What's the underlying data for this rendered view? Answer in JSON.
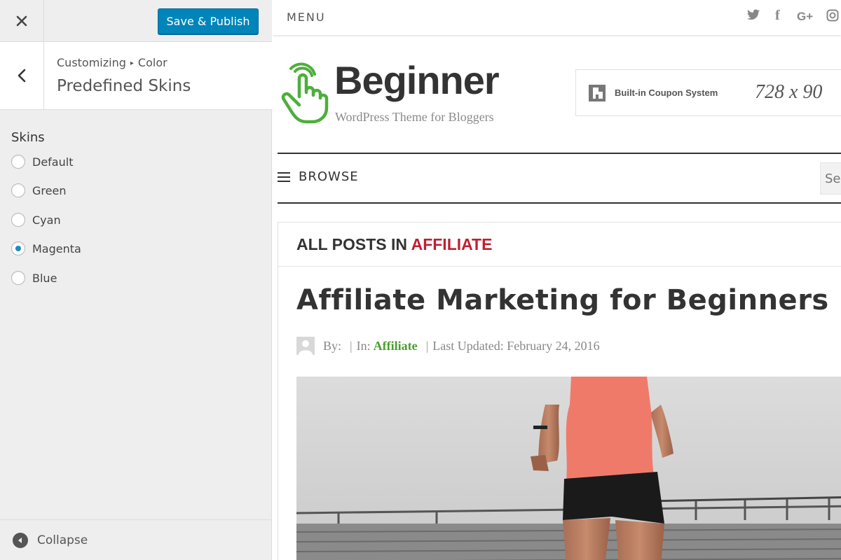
{
  "customizer": {
    "close_label": "×",
    "publish_label": "Save & Publish",
    "breadcrumb": {
      "root": "Customizing",
      "separator": "▸",
      "section": "Color"
    },
    "section_title": "Predefined Skins",
    "skins_label": "Skins",
    "skins": [
      {
        "label": "Default",
        "checked": false
      },
      {
        "label": "Green",
        "checked": false
      },
      {
        "label": "Cyan",
        "checked": false
      },
      {
        "label": "Magenta",
        "checked": true
      },
      {
        "label": "Blue",
        "checked": false
      }
    ],
    "collapse_label": "Collapse",
    "accent_color": "#0085ba"
  },
  "preview": {
    "menu_label": "MENU",
    "social_icons": [
      "twitter-icon",
      "facebook-icon",
      "google-plus-icon",
      "instagram-icon"
    ],
    "social_glyphs": {
      "twitter": "🐦",
      "facebook": "f",
      "google_plus": "G+",
      "instagram": "◎"
    },
    "site_title": "Beginner",
    "site_tagline": "WordPress Theme for Bloggers",
    "ad": {
      "text": "Built-in Coupon System",
      "size": "728 x 90"
    },
    "browse_label": "BROWSE",
    "search_placeholder": "Search",
    "archive": {
      "prefix": "ALL POSTS IN",
      "category": "AFFILIATE",
      "category_color": "#c01f31"
    },
    "post": {
      "title": "Affiliate Marketing for Beginners",
      "by_label": "By:",
      "in_label": "In:",
      "category": "Affiliate",
      "updated_label": "Last Updated: February 24, 2016",
      "category_color": "#4a9f30"
    },
    "logo_color": "#4caf3a"
  }
}
